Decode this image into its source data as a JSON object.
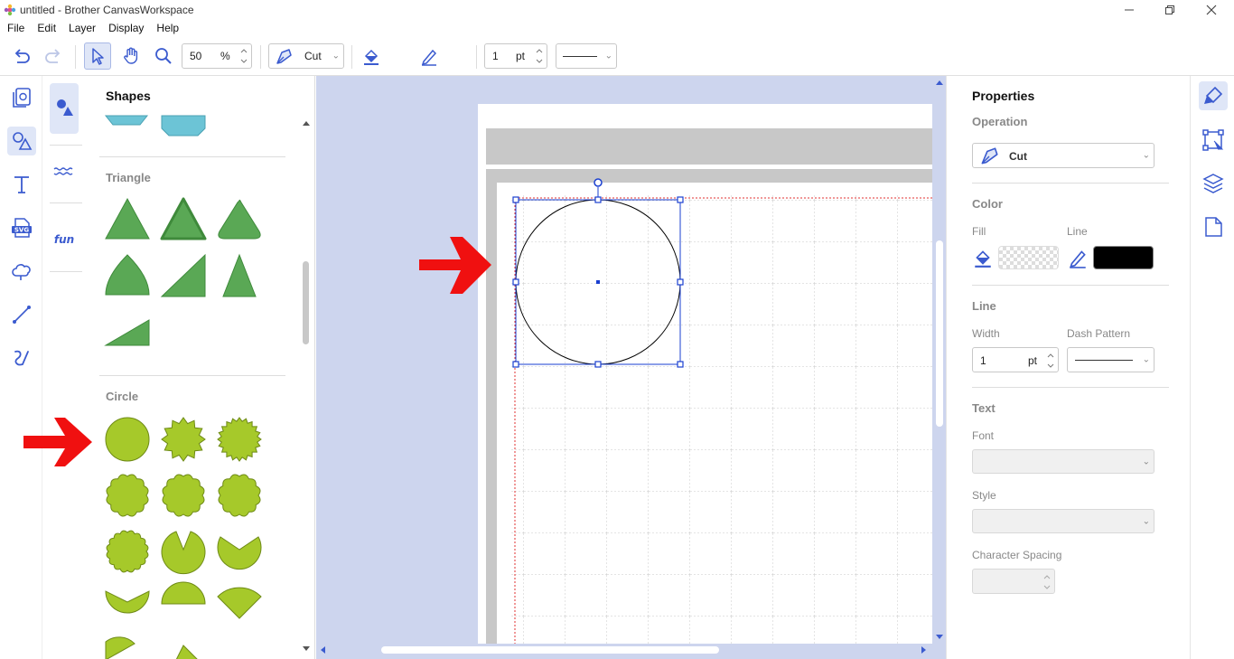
{
  "window": {
    "title": "untitled - Brother CanvasWorkspace"
  },
  "menu": {
    "items": [
      "File",
      "Edit",
      "Layer",
      "Display",
      "Help"
    ]
  },
  "toolbar": {
    "zoom_value": "50",
    "zoom_unit": "%",
    "operation": "Cut",
    "line_width": "1",
    "line_unit": "pt"
  },
  "shapes_panel": {
    "title": "Shapes",
    "sections": {
      "triangle": "Triangle",
      "circle": "Circle"
    }
  },
  "properties": {
    "title": "Properties",
    "operation_label": "Operation",
    "operation_value": "Cut",
    "color_label": "Color",
    "fill_label": "Fill",
    "line_label": "Line",
    "line_section": "Line",
    "width_label": "Width",
    "width_value": "1",
    "width_unit": "pt",
    "dash_label": "Dash Pattern",
    "text_section": "Text",
    "font_label": "Font",
    "style_label": "Style",
    "spacing_label": "Character Spacing"
  },
  "colors": {
    "accent": "#3b5bcf",
    "triangle_fill": "#5aa855",
    "circle_fill": "#a6c92a",
    "canvas_bg": "#cdd5ee",
    "annotation_arrow": "#f01010",
    "line_color": "#000000"
  }
}
